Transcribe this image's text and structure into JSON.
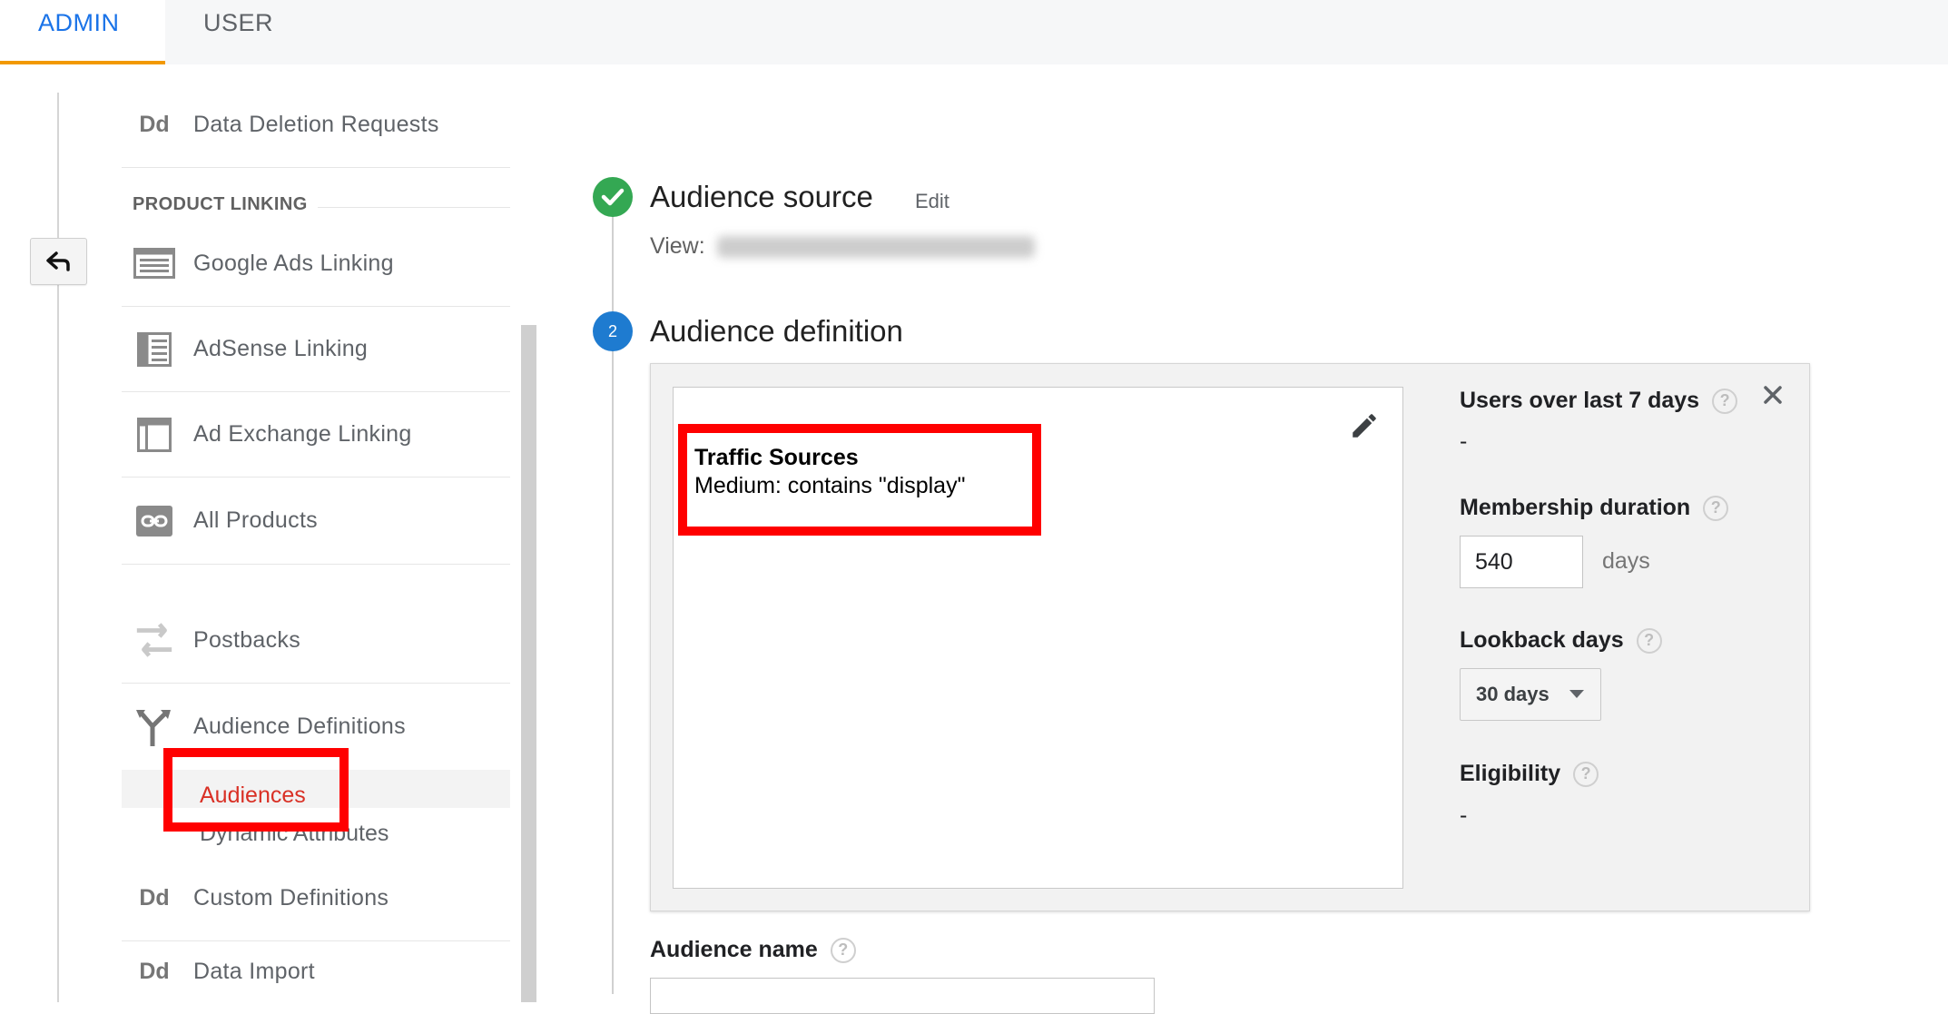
{
  "tabs": [
    {
      "label": "ADMIN",
      "active": true
    },
    {
      "label": "USER",
      "active": false
    }
  ],
  "menu": {
    "data_deletion": "Data Deletion Requests",
    "section_product_linking": "PRODUCT LINKING",
    "google_ads": "Google Ads Linking",
    "adsense": "AdSense Linking",
    "ad_exchange": "Ad Exchange Linking",
    "all_products": "All Products",
    "postbacks": "Postbacks",
    "audience_definitions": "Audience Definitions",
    "audiences": "Audiences",
    "dynamic_attributes": "Dynamic Attributes",
    "custom_definitions": "Custom Definitions",
    "data_import": "Data Import",
    "dd_icon_text": "Dd"
  },
  "steps": {
    "source": {
      "title": "Audience source",
      "edit": "Edit",
      "view_label": "View:"
    },
    "definition": {
      "number": "2",
      "title": "Audience definition"
    }
  },
  "condition": {
    "title": "Traffic Sources",
    "description": "Medium: contains \"display\""
  },
  "settings": {
    "users_label": "Users over last 7 days",
    "users_value": "-",
    "membership_label": "Membership duration",
    "membership_value": "540",
    "membership_unit": "days",
    "lookback_label": "Lookback days",
    "lookback_value": "30 days",
    "eligibility_label": "Eligibility",
    "eligibility_value": "-",
    "help_glyph": "?"
  },
  "audience_name": {
    "label": "Audience name"
  },
  "colors": {
    "accent_blue": "#1a73e8",
    "tab_underline": "#f29900",
    "check_green": "#34a853",
    "step_blue": "#1e7bd0",
    "highlight_red": "#ff0000",
    "active_link_red": "#d93025"
  }
}
